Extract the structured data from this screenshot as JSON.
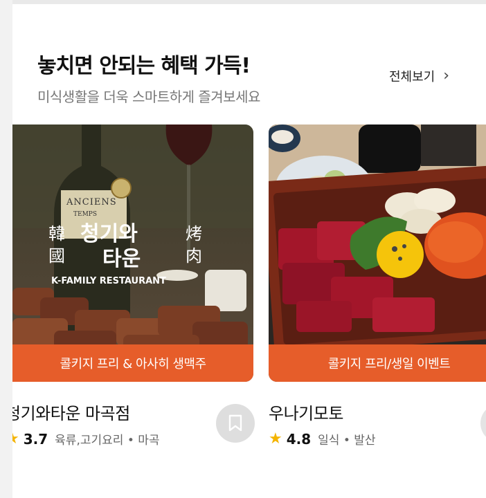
{
  "header": {
    "title": "놓치면 안되는 혜택 가득!",
    "subtitle": "미식생활을 더욱 스마트하게 즐겨보세요",
    "see_all": "전체보기",
    "chevron": "›"
  },
  "cards": [
    {
      "name": "청기와타운 마곡점",
      "rating": "3.7",
      "category": "육류,고기요리 • 마곡",
      "banner": "콜키지 프리 & 아사히 생맥주",
      "image_text": {
        "left_top": "韓",
        "left_bottom": "國",
        "right_top": "烤",
        "right_bottom": "肉",
        "brand_1": "청기와",
        "brand_2": "타운",
        "tagline": "K-FAMILY RESTAURANT",
        "bottle_label": "ANCIENS",
        "bottle_sub": "TEMPS"
      },
      "icon": "bookmark-icon"
    },
    {
      "name": "우나기모토",
      "rating": "4.8",
      "category": "일식 • 발산",
      "banner": "콜키지 프리/생일 이벤트",
      "icon": "bookmark-icon"
    }
  ],
  "colors": {
    "banner": "#e65d2a",
    "star": "#f4b400"
  }
}
